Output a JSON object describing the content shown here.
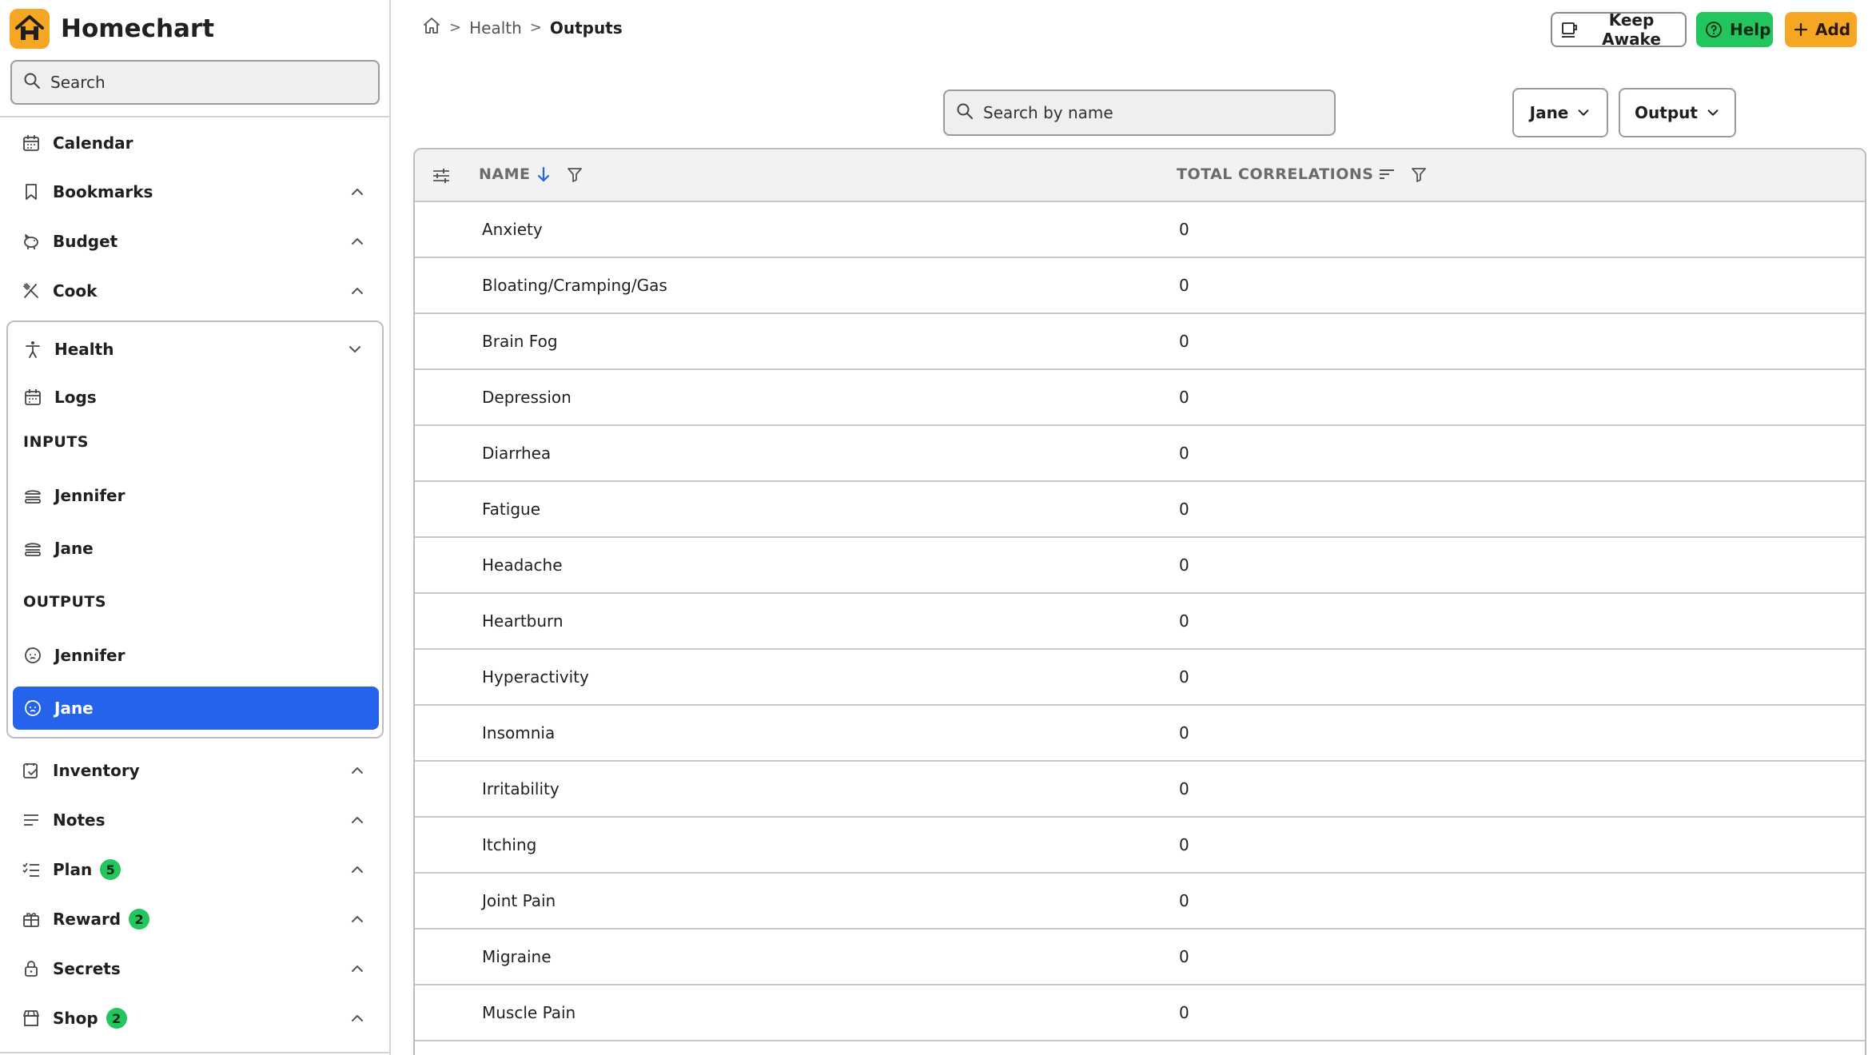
{
  "app": {
    "name": "Homechart"
  },
  "sidebar": {
    "search_placeholder": "Search",
    "items": [
      {
        "label": "Calendar"
      },
      {
        "label": "Bookmarks"
      },
      {
        "label": "Budget"
      },
      {
        "label": "Cook"
      }
    ],
    "health": {
      "label": "Health",
      "logs": "Logs",
      "inputs_header": "INPUTS",
      "inputs": [
        "Jennifer",
        "Jane"
      ],
      "outputs_header": "OUTPUTS",
      "outputs": [
        "Jennifer",
        "Jane"
      ],
      "active": "Jane"
    },
    "items_after": [
      {
        "label": "Inventory"
      },
      {
        "label": "Notes"
      },
      {
        "label": "Plan",
        "badge": "5"
      },
      {
        "label": "Reward",
        "badge": "2"
      },
      {
        "label": "Secrets"
      },
      {
        "label": "Shop",
        "badge": "2"
      }
    ]
  },
  "breadcrumb": {
    "section": "Health",
    "current": "Outputs"
  },
  "toolbar": {
    "keep_awake": "Keep Awake",
    "help": "Help",
    "add": "Add"
  },
  "filters": {
    "search_placeholder": "Search by name",
    "person": "Jane",
    "type": "Output"
  },
  "table": {
    "columns": {
      "name": "NAME",
      "correlations": "TOTAL CORRELATIONS"
    },
    "rows": [
      {
        "name": "Anxiety",
        "correlations": "0"
      },
      {
        "name": "Bloating/Cramping/Gas",
        "correlations": "0"
      },
      {
        "name": "Brain Fog",
        "correlations": "0"
      },
      {
        "name": "Depression",
        "correlations": "0"
      },
      {
        "name": "Diarrhea",
        "correlations": "0"
      },
      {
        "name": "Fatigue",
        "correlations": "0"
      },
      {
        "name": "Headache",
        "correlations": "0"
      },
      {
        "name": "Heartburn",
        "correlations": "0"
      },
      {
        "name": "Hyperactivity",
        "correlations": "0"
      },
      {
        "name": "Insomnia",
        "correlations": "0"
      },
      {
        "name": "Irritability",
        "correlations": "0"
      },
      {
        "name": "Itching",
        "correlations": "0"
      },
      {
        "name": "Joint Pain",
        "correlations": "0"
      },
      {
        "name": "Migraine",
        "correlations": "0"
      },
      {
        "name": "Muscle Pain",
        "correlations": "0"
      }
    ]
  },
  "colors": {
    "accent": "#2563eb",
    "brand": "#f5a623",
    "help": "#22c55e",
    "badge": "#22c55e"
  }
}
